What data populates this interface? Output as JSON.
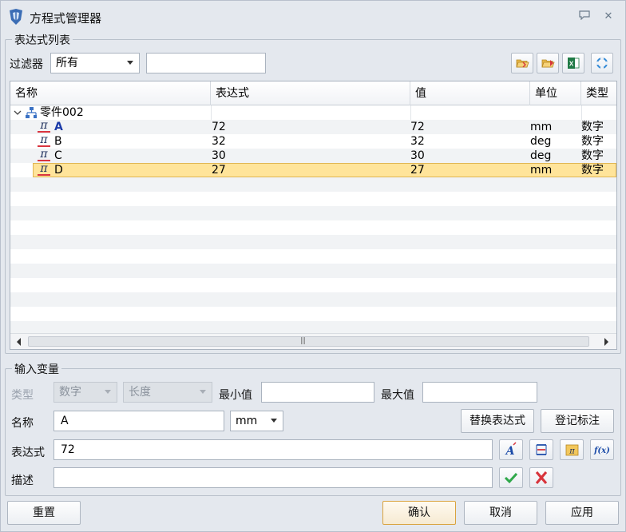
{
  "window": {
    "title": "方程式管理器"
  },
  "list_group": {
    "title": "表达式列表",
    "filter_label": "过滤器",
    "filter_value": "所有",
    "filter_text": ""
  },
  "table": {
    "columns": [
      "名称",
      "表达式",
      "值",
      "单位",
      "类型"
    ],
    "root": {
      "label": "零件002"
    },
    "rows": [
      {
        "name": "A",
        "expr": "72",
        "value": "72",
        "unit": "mm",
        "type": "数字",
        "selected": false,
        "bold": true
      },
      {
        "name": "B",
        "expr": "32",
        "value": "32",
        "unit": "deg",
        "type": "数字",
        "selected": false,
        "bold": false
      },
      {
        "name": "C",
        "expr": "30",
        "value": "30",
        "unit": "deg",
        "type": "数字",
        "selected": false,
        "bold": false
      },
      {
        "name": "D",
        "expr": "27",
        "value": "27",
        "unit": "mm",
        "type": "数字",
        "selected": true,
        "bold": false
      }
    ]
  },
  "input_group": {
    "title": "输入变量",
    "type_label": "类型",
    "type_value": "数字",
    "subtype_value": "长度",
    "min_label": "最小值",
    "min_value": "",
    "max_label": "最大值",
    "max_value": "",
    "name_label": "名称",
    "name_value": "A",
    "unit_value": "mm",
    "replace_button": "替换表达式",
    "annotate_button": "登记标注",
    "expr_label": "表达式",
    "expr_value": "72",
    "desc_label": "描述",
    "desc_value": ""
  },
  "footer": {
    "reset": "重置",
    "ok": "确认",
    "cancel": "取消",
    "apply": "应用"
  },
  "colors": {
    "selection_fill": "#ffe49a",
    "selection_border": "#e0b552",
    "accent_blue": "#1a3aa8",
    "confirm_green": "#2fa84a",
    "delete_red": "#d8343c"
  }
}
